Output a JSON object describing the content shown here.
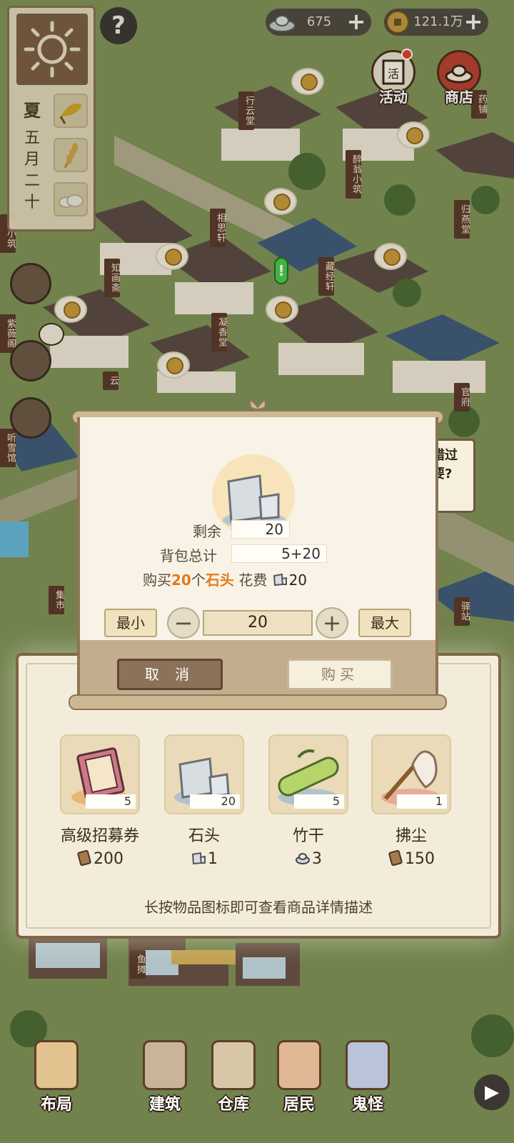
{
  "hud": {
    "season": "夏",
    "date": "五月二十",
    "help_glyph": "?",
    "silver": "675",
    "coins": "121.1万",
    "plus_glyph": "+",
    "event_label": "活动",
    "shop_label": "商店"
  },
  "map_labels": [
    "行云堂",
    "醉翁小筑",
    "归燕堂",
    "相思轩",
    "藏经轩",
    "知画斋",
    "凝香堂",
    "紫薇阁",
    "听雪馆",
    "官府",
    "集市",
    "驿站",
    "鱼摊",
    "云",
    "画小筑",
    "药铺"
  ],
  "bubble_right_text": "错过要?",
  "dialog": {
    "remaining_label": "剩余",
    "remaining_value": "20",
    "bag_total_label": "背包总计",
    "bag_total_value": "5+20",
    "buy_prefix": "购买",
    "buy_qty": "20",
    "buy_unit": "个",
    "item_name": "石头",
    "cost_label": "花费",
    "cost_value": "20",
    "min_label": "最小",
    "max_label": "最大",
    "minus_glyph": "−",
    "plus_glyph": "+",
    "quantity": "20",
    "cancel_label": "取 消",
    "buy_label": "购买"
  },
  "shop": {
    "items": [
      {
        "name": "高级招募券",
        "count": "5",
        "price": "200",
        "currency_icon": "paper-scroll-icon",
        "icon": "recruit-ticket-icon"
      },
      {
        "name": "石头",
        "count": "20",
        "price": "1",
        "currency_icon": "stone-icon",
        "icon": "stone-icon"
      },
      {
        "name": "竹干",
        "count": "5",
        "price": "3",
        "currency_icon": "silver-ingot-icon",
        "icon": "bamboo-icon"
      },
      {
        "name": "拂尘",
        "count": "1",
        "price": "150",
        "currency_icon": "paper-scroll-icon",
        "icon": "whisk-icon"
      }
    ],
    "hint": "长按物品图标即可查看商品详情描述"
  },
  "nav": [
    {
      "label": "布局",
      "icon": "layout-icon"
    },
    {
      "label": "建筑",
      "icon": "building-icon"
    },
    {
      "label": "仓库",
      "icon": "warehouse-icon"
    },
    {
      "label": "居民",
      "icon": "residents-icon"
    },
    {
      "label": "鬼怪",
      "icon": "ghost-icon"
    }
  ],
  "colors": {
    "accent_orange": "#e27b1e",
    "panel_brown": "#8e7557",
    "paper": "#f8f3e6"
  }
}
